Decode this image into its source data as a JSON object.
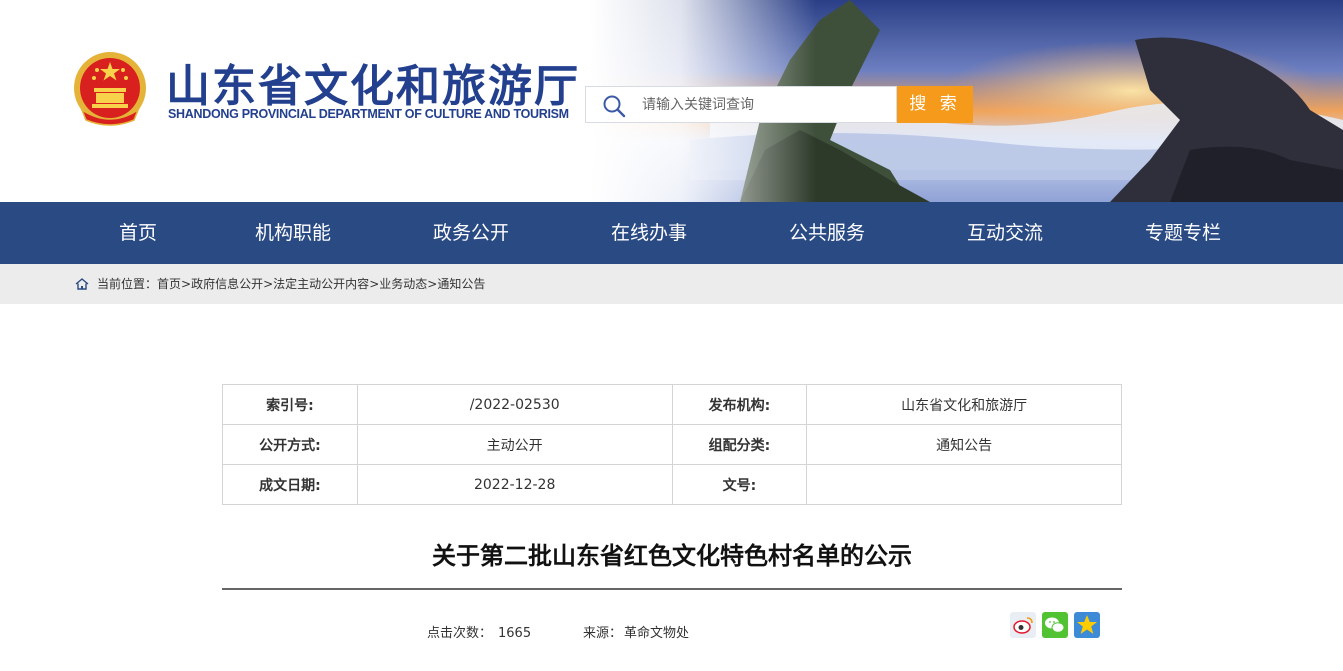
{
  "site": {
    "title_cn": "山东省文化和旅游厅",
    "title_en": "SHANDONG PROVINCIAL DEPARTMENT OF CULTURE AND TOURISM"
  },
  "search": {
    "placeholder": "请输入关键词查询",
    "button_label": "搜 索"
  },
  "nav": {
    "items": [
      "首页",
      "机构职能",
      "政务公开",
      "在线办事",
      "公共服务",
      "互动交流",
      "专题专栏"
    ]
  },
  "breadcrumb": {
    "prefix": "当前位置：",
    "items": [
      "首页",
      "政府信息公开",
      "法定主动公开内容",
      "业务动态",
      "通知公告"
    ],
    "separator": ">"
  },
  "meta": {
    "index_label": "索引号:",
    "index_value": "/2022-02530",
    "publisher_label": "发布机构:",
    "publisher_value": "山东省文化和旅游厅",
    "method_label": "公开方式:",
    "method_value": "主动公开",
    "category_label": "组配分类:",
    "category_value": "通知公告",
    "date_label": "成文日期:",
    "date_value": "2022-12-28",
    "docno_label": "文号:",
    "docno_value": ""
  },
  "article": {
    "title": "关于第二批山东省红色文化特色村名单的公示",
    "clicks_label": "点击次数：",
    "clicks_value": "1665",
    "source_label": "来源：",
    "source_value": "革命文物处"
  },
  "share_icons": [
    "weibo-icon",
    "wechat-icon",
    "qzone-icon"
  ],
  "colors": {
    "brand_blue": "#23408e",
    "nav_bg": "#2a4a83",
    "search_button": "#f59a1b",
    "crumb_bg": "#ececec"
  }
}
